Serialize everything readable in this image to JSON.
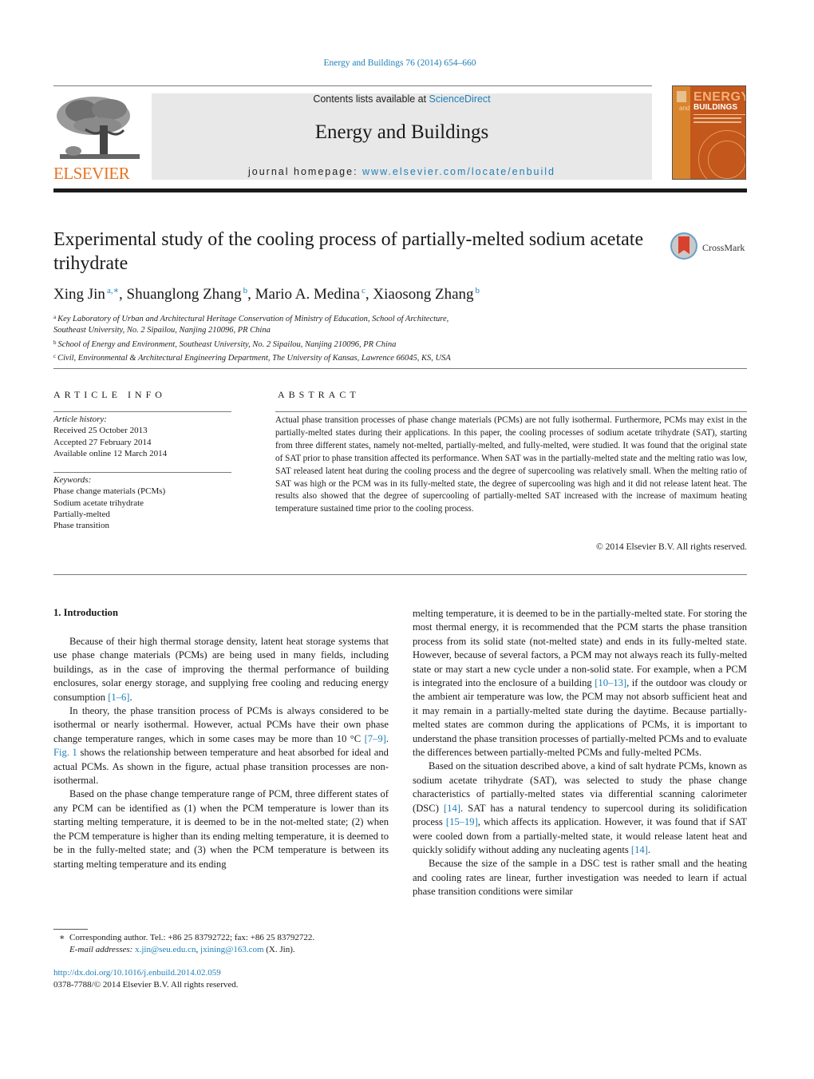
{
  "header": {
    "journal_ref": "Energy and Buildings 76 (2014) 654–660",
    "contents_prefix": "Contents lists available at ",
    "contents_link": "ScienceDirect",
    "journal_title": "Energy and Buildings",
    "homepage_prefix": "journal homepage: ",
    "homepage_link": "www.elsevier.com/locate/enbuild",
    "publisher_logo_text": "ELSEVIER",
    "cover": {
      "title_line1": "ENERGY",
      "title_and": "and",
      "title_line2": "BUILDINGS"
    },
    "colors": {
      "link": "#1f7fb8",
      "elsevier_orange": "#e8731f",
      "cover_orange": "#c4571b"
    }
  },
  "article": {
    "title": "Experimental study of the cooling process of partially-melted sodium acetate trihydrate",
    "crossmark_label": "CrossMark",
    "authors": [
      {
        "name": "Xing Jin",
        "sup": "a,∗"
      },
      {
        "name": "Shuanglong Zhang",
        "sup": "b"
      },
      {
        "name": "Mario A. Medina",
        "sup": "c"
      },
      {
        "name": "Xiaosong Zhang",
        "sup": "b"
      }
    ],
    "affiliations": [
      {
        "key": "a",
        "lines": [
          "Key Laboratory of Urban and Architectural Heritage Conservation of Ministry of Education, School of Architecture,",
          "Southeast University, No. 2 Sipailou, Nanjing 210096, PR China"
        ]
      },
      {
        "key": "b",
        "lines": [
          "School of Energy and Environment, Southeast University, No. 2 Sipailou, Nanjing 210096, PR China"
        ]
      },
      {
        "key": "c",
        "lines": [
          "Civil, Environmental & Architectural Engineering Department, The University of Kansas, Lawrence 66045, KS, USA"
        ]
      }
    ]
  },
  "article_info": {
    "heading": "ARTICLE INFO",
    "history_label": "Article history:",
    "received": "Received 25 October 2013",
    "accepted": "Accepted 27 February 2014",
    "online": "Available online 12 March 2014",
    "keywords_label": "Keywords:",
    "keywords": [
      "Phase change materials (PCMs)",
      "Sodium acetate trihydrate",
      "Partially-melted",
      "Phase transition"
    ]
  },
  "abstract": {
    "heading": "ABSTRACT",
    "text": "Actual phase transition processes of phase change materials (PCMs) are not fully isothermal. Furthermore, PCMs may exist in the partially-melted states during their applications. In this paper, the cooling processes of sodium acetate trihydrate (SAT), starting from three different states, namely not-melted, partially-melted, and fully-melted, were studied. It was found that the original state of SAT prior to phase transition affected its performance. When SAT was in the partially-melted state and the melting ratio was low, SAT released latent heat during the cooling process and the degree of supercooling was relatively small. When the melting ratio of SAT was high or the PCM was in its fully-melted state, the degree of supercooling was high and it did not release latent heat. The results also showed that the degree of supercooling of partially-melted SAT increased with the increase of maximum heating temperature sustained time prior to the cooling process.",
    "copyright": "© 2014 Elsevier B.V. All rights reserved."
  },
  "body": {
    "section_heading": "1.  Introduction",
    "left_paragraphs": [
      {
        "parts": [
          {
            "t": "Because of their high thermal storage density, latent heat storage systems that use phase change materials (PCMs) are being used in many fields, including buildings, as in the case of improving the thermal performance of building enclosures, solar energy storage, and supplying free cooling and reducing energy consumption "
          },
          {
            "t": "[1–6]",
            "link": true
          },
          {
            "t": "."
          }
        ]
      },
      {
        "parts": [
          {
            "t": "In theory, the phase transition process of PCMs is always considered to be isothermal or nearly isothermal. However, actual PCMs have their own phase change temperature ranges, which in some cases may be more than 10 °C "
          },
          {
            "t": "[7–9]",
            "link": true
          },
          {
            "t": ". "
          },
          {
            "t": "Fig. 1",
            "link": true
          },
          {
            "t": " shows the relationship between temperature and heat absorbed for ideal and actual PCMs. As shown in the figure, actual phase transition processes are non-isothermal."
          }
        ]
      },
      {
        "parts": [
          {
            "t": "Based on the phase change temperature range of PCM, three different states of any PCM can be identified as (1) when the PCM temperature is lower than its starting melting temperature, it is deemed to be in the not-melted state; (2) when the PCM temperature is higher than its ending melting temperature, it is deemed to be in the fully-melted state; and (3) when the PCM temperature is between its starting melting temperature and its ending"
          }
        ]
      }
    ],
    "right_paragraphs": [
      {
        "noindent": true,
        "parts": [
          {
            "t": "melting temperature, it is deemed to be in the partially-melted state. For storing the most thermal energy, it is recommended that the PCM starts the phase transition process from its solid state (not-melted state) and ends in its fully-melted state. However, because of several factors, a PCM may not always reach its fully-melted state or may start a new cycle under a non-solid state. For example, when a PCM is integrated into the enclosure of a building "
          },
          {
            "t": "[10–13]",
            "link": true
          },
          {
            "t": ", if the outdoor was cloudy or the ambient air temperature was low, the PCM may not absorb sufficient heat and it may remain in a partially-melted state during the daytime. Because partially-melted states are common during the applications of PCMs, it is important to understand the phase transition processes of partially-melted PCMs and to evaluate the differences between partially-melted PCMs and fully-melted PCMs."
          }
        ]
      },
      {
        "parts": [
          {
            "t": "Based on the situation described above, a kind of salt hydrate PCMs, known as sodium acetate trihydrate (SAT), was selected to study the phase change characteristics of partially-melted states via differential scanning calorimeter (DSC) "
          },
          {
            "t": "[14]",
            "link": true
          },
          {
            "t": ". SAT has a natural tendency to supercool during its solidification process "
          },
          {
            "t": "[15–19]",
            "link": true
          },
          {
            "t": ", which affects its application. However, it was found that if SAT were cooled down from a partially-melted state, it would release latent heat and quickly solidify without adding any nucleating agents "
          },
          {
            "t": "[14]",
            "link": true
          },
          {
            "t": "."
          }
        ]
      },
      {
        "parts": [
          {
            "t": "Because the size of the sample in a DSC test is rather small and the heating and cooling rates are linear, further investigation was needed to learn if actual phase transition conditions were similar"
          }
        ]
      }
    ]
  },
  "footnotes": {
    "marker": "∗",
    "corresponding": "Corresponding author. Tel.: +86 25 83792722; fax: +86 25 83792722.",
    "email_label": "E-mail addresses:",
    "email1": "x.jin@seu.edu.cn",
    "email2": "jxining@163.com",
    "email_suffix": " (X. Jin).",
    "doi": "http://dx.doi.org/10.1016/j.enbuild.2014.02.059",
    "issn": "0378-7788/© 2014 Elsevier B.V. All rights reserved."
  }
}
